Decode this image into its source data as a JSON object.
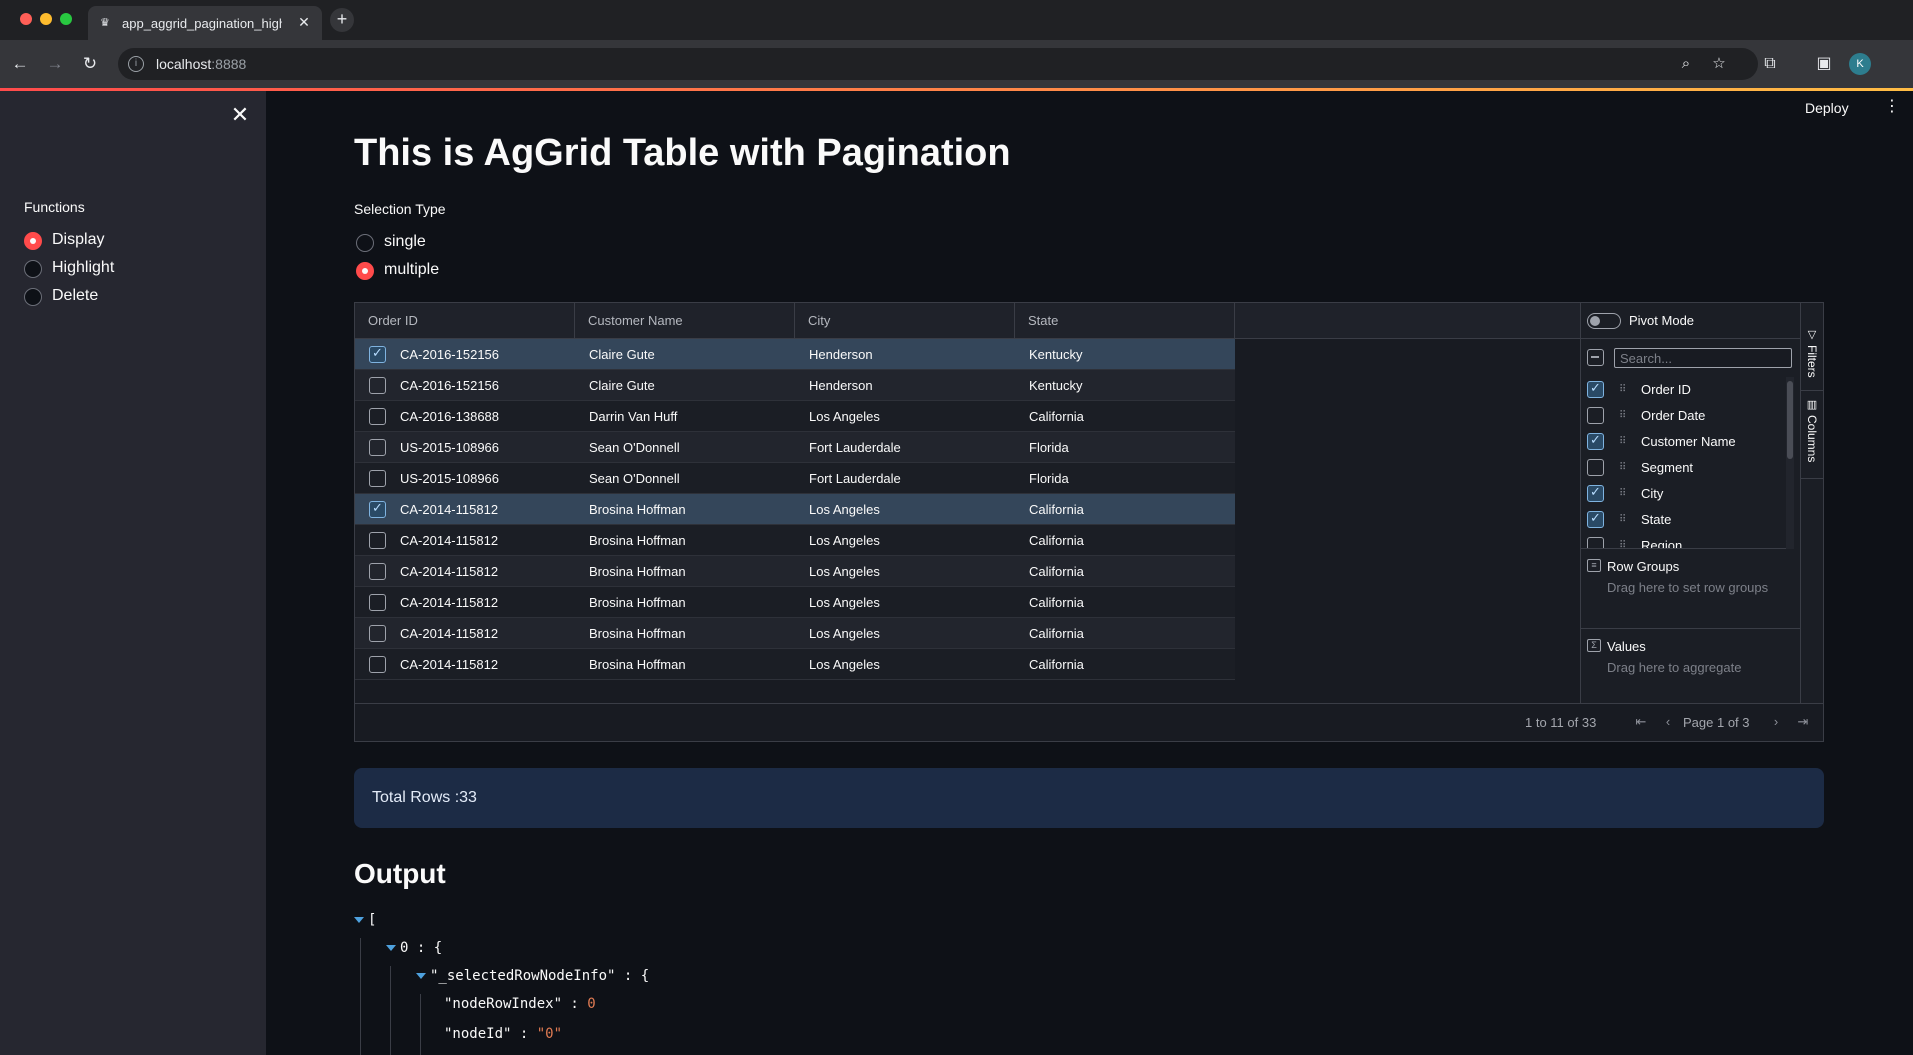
{
  "browser": {
    "tab_title": "app_aggrid_pagination_highlight",
    "url_host": "localhost",
    "url_port": ":8888",
    "profile_initial": "K"
  },
  "sidebar": {
    "group_label": "Functions",
    "options": [
      {
        "label": "Display",
        "selected": true
      },
      {
        "label": "Highlight",
        "selected": false
      },
      {
        "label": "Delete",
        "selected": false
      }
    ]
  },
  "header": {
    "deploy_label": "Deploy"
  },
  "main": {
    "title": "This is AgGrid Table with Pagination",
    "selection_label": "Selection Type",
    "selection_options": [
      {
        "label": "single",
        "selected": false
      },
      {
        "label": "multiple",
        "selected": true
      }
    ]
  },
  "grid": {
    "columns": [
      "Order ID",
      "Customer Name",
      "City",
      "State"
    ],
    "rows": [
      {
        "selected": true,
        "order_id": "CA-2016-152156",
        "customer": "Claire Gute",
        "city": "Henderson",
        "state": "Kentucky"
      },
      {
        "selected": false,
        "order_id": "CA-2016-152156",
        "customer": "Claire Gute",
        "city": "Henderson",
        "state": "Kentucky"
      },
      {
        "selected": false,
        "order_id": "CA-2016-138688",
        "customer": "Darrin Van Huff",
        "city": "Los Angeles",
        "state": "California"
      },
      {
        "selected": false,
        "order_id": "US-2015-108966",
        "customer": "Sean O'Donnell",
        "city": "Fort Lauderdale",
        "state": "Florida"
      },
      {
        "selected": false,
        "order_id": "US-2015-108966",
        "customer": "Sean O'Donnell",
        "city": "Fort Lauderdale",
        "state": "Florida"
      },
      {
        "selected": true,
        "order_id": "CA-2014-115812",
        "customer": "Brosina Hoffman",
        "city": "Los Angeles",
        "state": "California"
      },
      {
        "selected": false,
        "order_id": "CA-2014-115812",
        "customer": "Brosina Hoffman",
        "city": "Los Angeles",
        "state": "California"
      },
      {
        "selected": false,
        "order_id": "CA-2014-115812",
        "customer": "Brosina Hoffman",
        "city": "Los Angeles",
        "state": "California"
      },
      {
        "selected": false,
        "order_id": "CA-2014-115812",
        "customer": "Brosina Hoffman",
        "city": "Los Angeles",
        "state": "California"
      },
      {
        "selected": false,
        "order_id": "CA-2014-115812",
        "customer": "Brosina Hoffman",
        "city": "Los Angeles",
        "state": "California"
      },
      {
        "selected": false,
        "order_id": "CA-2014-115812",
        "customer": "Brosina Hoffman",
        "city": "Los Angeles",
        "state": "California"
      }
    ],
    "pagination": {
      "summary": "1 to 11 of 33",
      "page_text": "Page 1 of 3"
    },
    "tool_panel": {
      "pivot_label": "Pivot Mode",
      "search_placeholder": "Search...",
      "columns": [
        {
          "name": "Order ID",
          "checked": true
        },
        {
          "name": "Order Date",
          "checked": false
        },
        {
          "name": "Customer Name",
          "checked": true
        },
        {
          "name": "Segment",
          "checked": false
        },
        {
          "name": "City",
          "checked": true
        },
        {
          "name": "State",
          "checked": true
        },
        {
          "name": "Region",
          "checked": false
        }
      ],
      "row_groups_title": "Row Groups",
      "row_groups_hint": "Drag here to set row groups",
      "values_title": "Values",
      "values_hint": "Drag here to aggregate",
      "side_tabs": [
        "Filters",
        "Columns"
      ]
    }
  },
  "info": {
    "text": "Total Rows :33"
  },
  "output": {
    "title": "Output",
    "json_lines": [
      {
        "text": "[",
        "caret": true
      },
      {
        "text": "0 : {",
        "caret": true
      },
      {
        "text": "\"_selectedRowNodeInfo\" : {",
        "caret": true
      },
      {
        "key": "\"nodeRowIndex\" : ",
        "value": "0"
      },
      {
        "key": "\"nodeId\" : ",
        "value": "\"0\""
      }
    ]
  },
  "colors": {
    "accent": "#ff4b4b",
    "background": "#0e1117",
    "sidebar": "#262730",
    "selected_row": "#34465a",
    "info_box": "#1c2b45"
  }
}
